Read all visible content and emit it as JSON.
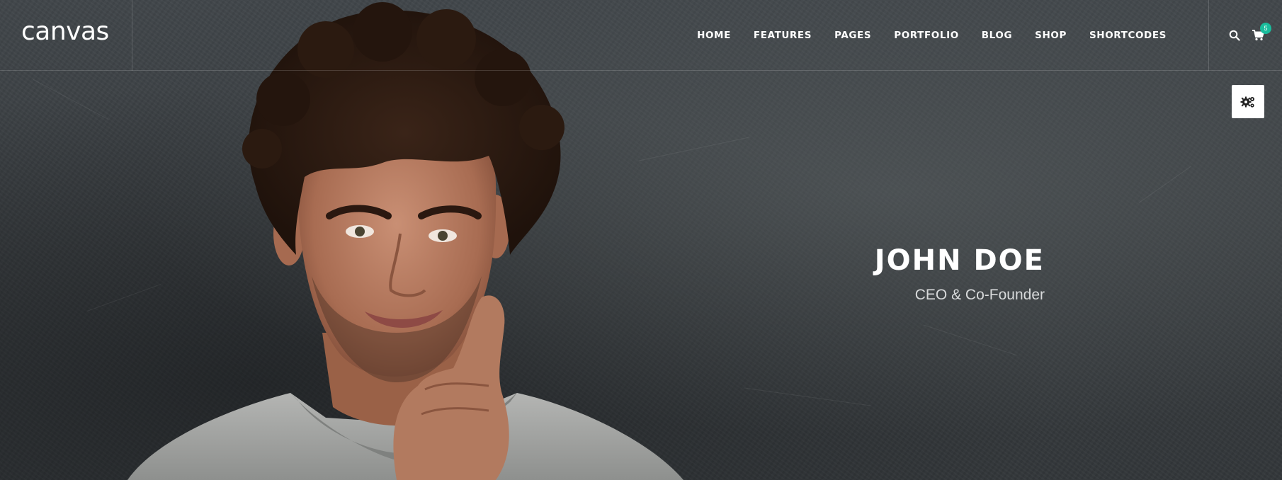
{
  "header": {
    "logo": "canvas",
    "nav": [
      {
        "label": "HOME"
      },
      {
        "label": "FEATURES"
      },
      {
        "label": "PAGES"
      },
      {
        "label": "PORTFOLIO"
      },
      {
        "label": "BLOG"
      },
      {
        "label": "SHOP"
      },
      {
        "label": "SHORTCODES"
      }
    ],
    "cart_count": "5",
    "icons": {
      "search": "search-icon",
      "cart": "cart-icon",
      "settings": "gears-icon"
    }
  },
  "hero": {
    "name": "JOHN DOE",
    "role": "CEO & Co-Founder"
  },
  "colors": {
    "background": "#3a3e40",
    "accent": "#1abc9c",
    "text": "#ffffff"
  }
}
